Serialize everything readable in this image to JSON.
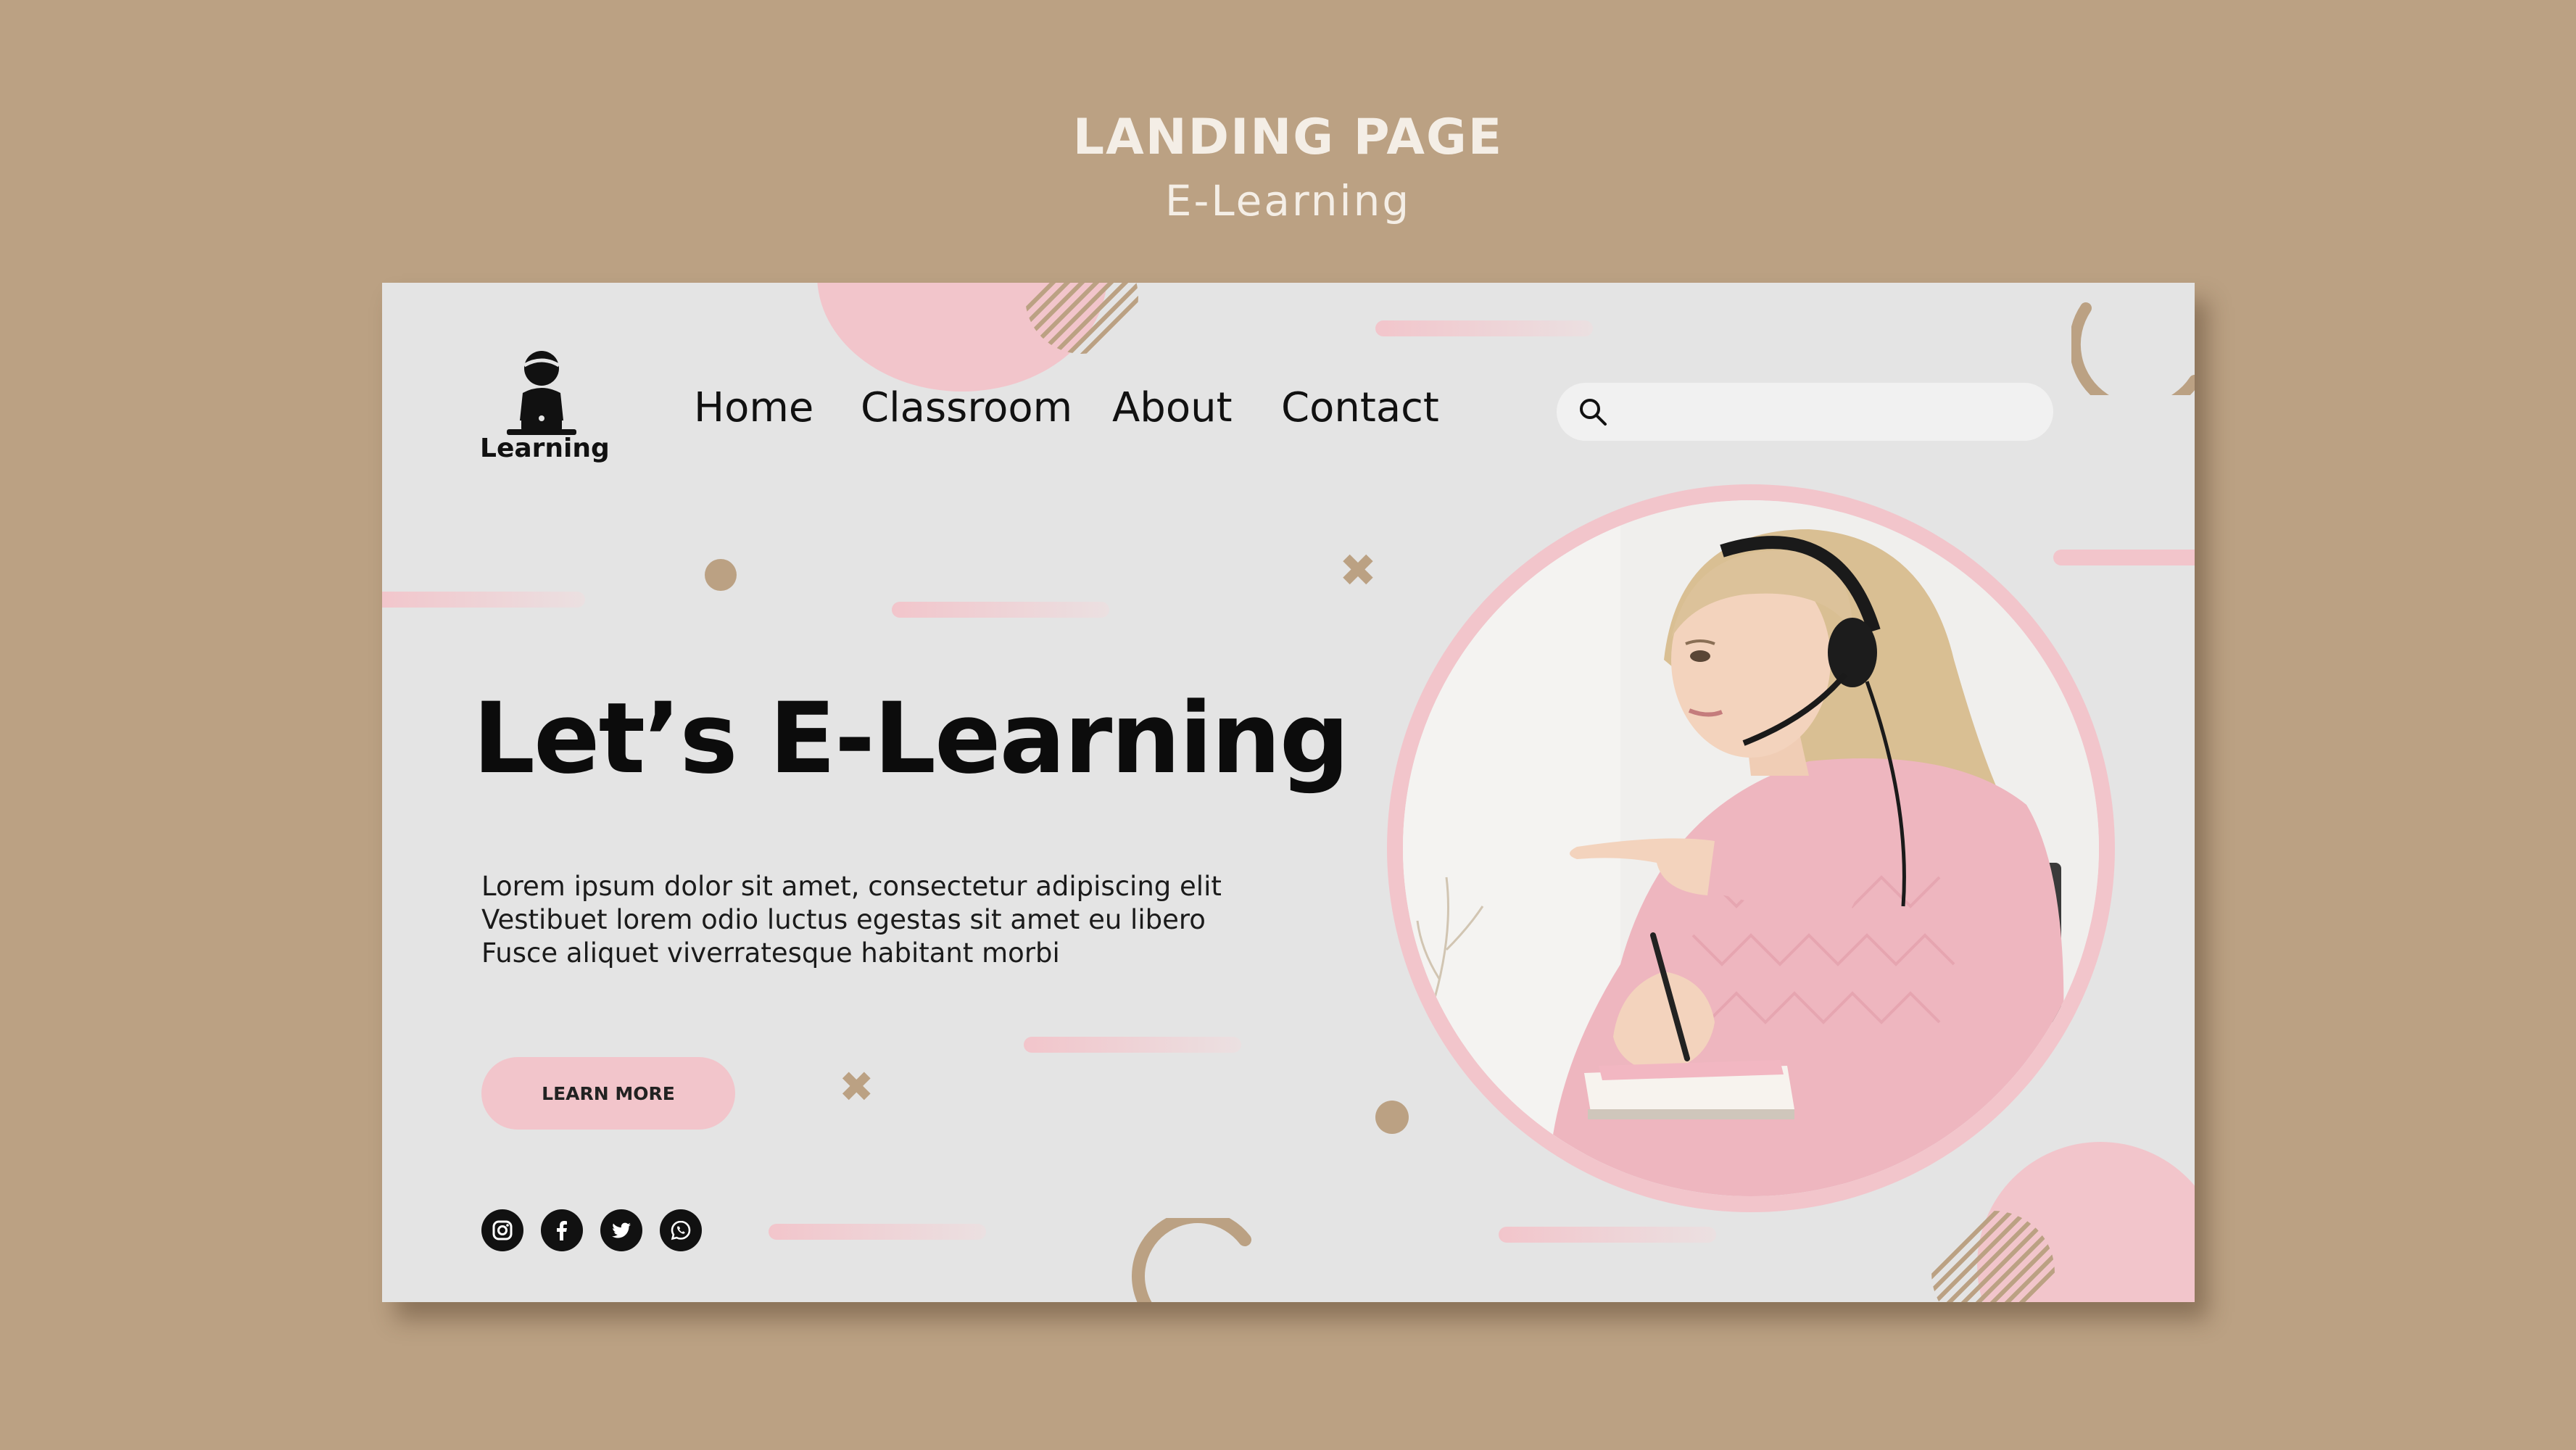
{
  "showcase": {
    "title": "LANDING PAGE",
    "subtitle": "E-Learning"
  },
  "logo": {
    "label": "Learning",
    "icon": "teacher-laptop-icon"
  },
  "nav": {
    "items": [
      {
        "label": "Home"
      },
      {
        "label": "Classroom"
      },
      {
        "label": "About"
      },
      {
        "label": "Contact"
      }
    ]
  },
  "search": {
    "placeholder": "",
    "value": "",
    "icon": "search-icon"
  },
  "hero": {
    "title": "Let’s E-Learning",
    "body_lines": [
      "Lorem ipsum dolor sit amet, consectetur adipiscing elit",
      "Vestibuet lorem odio luctus egestas sit amet eu libero",
      "Fusce aliquet viverratesque habitant morbi"
    ],
    "cta_label": "LEARN MORE"
  },
  "socials": [
    {
      "icon": "instagram-icon"
    },
    {
      "icon": "facebook-icon"
    },
    {
      "icon": "twitter-icon"
    },
    {
      "icon": "whatsapp-icon"
    }
  ],
  "colors": {
    "background": "#bba183",
    "card": "#e4e4e4",
    "accent_pink": "#f2c5cb",
    "accent_tan": "#bba183",
    "text_dark": "#0c0c0c"
  }
}
